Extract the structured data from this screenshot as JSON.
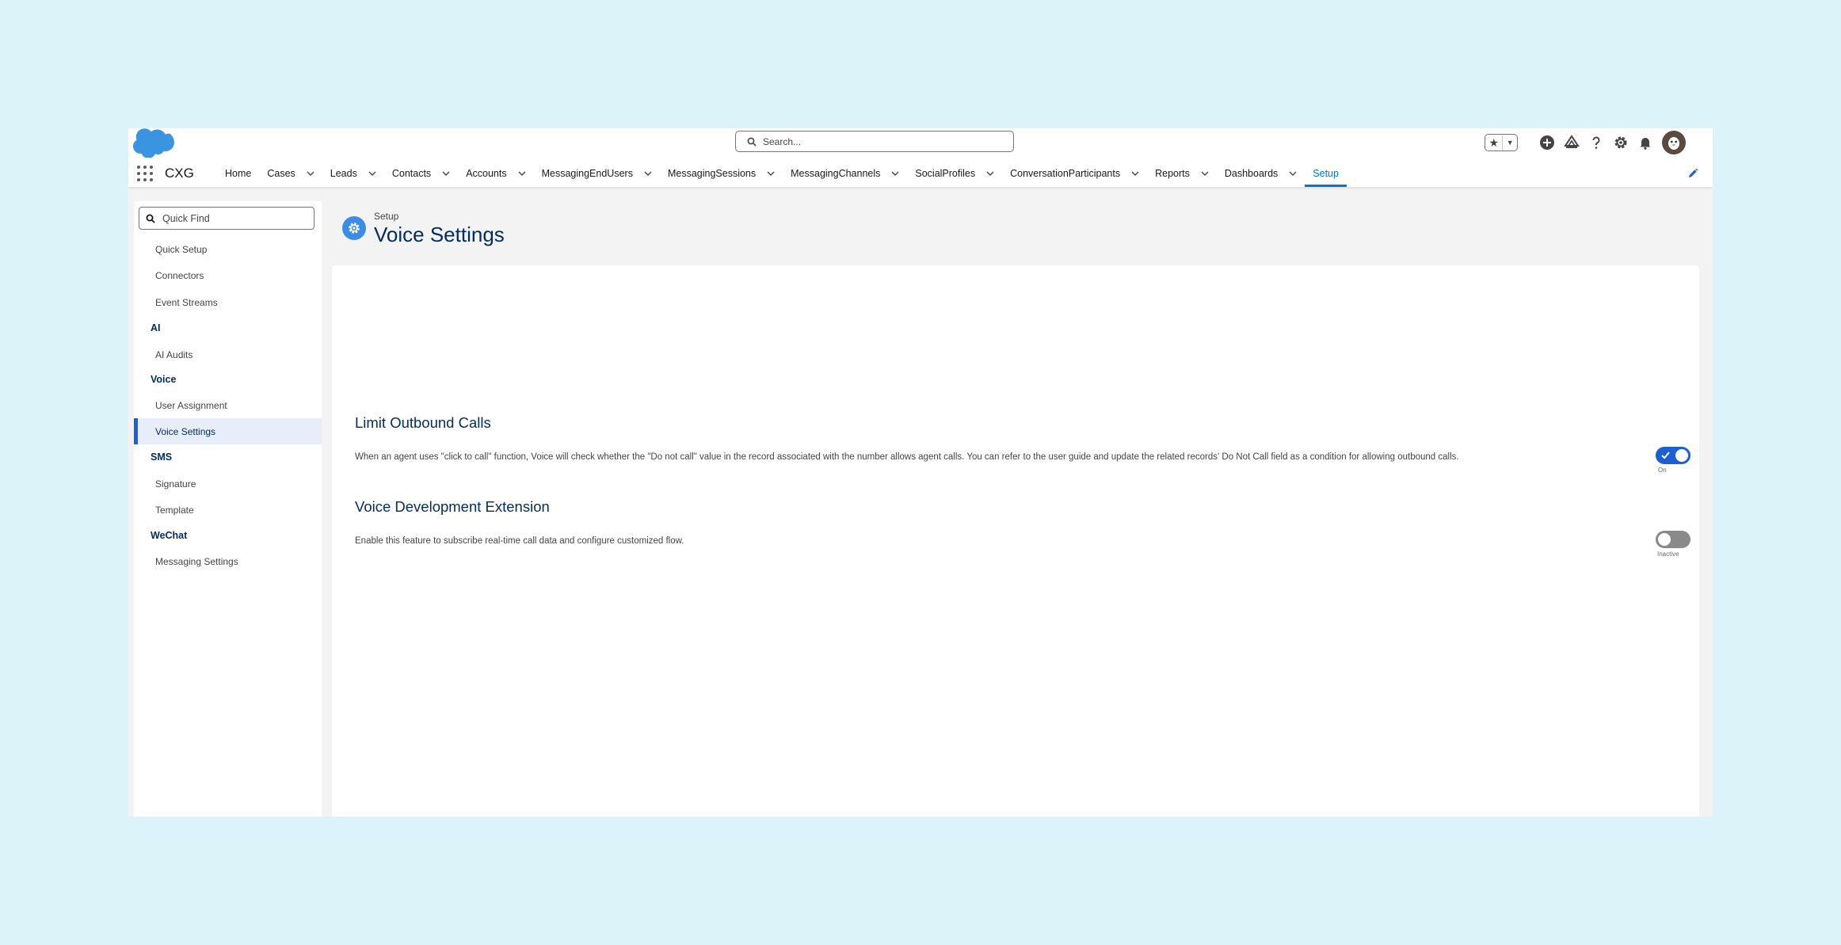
{
  "header": {
    "search_placeholder": "Search..."
  },
  "nav": {
    "app_name": "CXG",
    "items": [
      {
        "label": "Home",
        "has_menu": false
      },
      {
        "label": "Cases",
        "has_menu": true
      },
      {
        "label": "Leads",
        "has_menu": true
      },
      {
        "label": "Contacts",
        "has_menu": true
      },
      {
        "label": "Accounts",
        "has_menu": true
      },
      {
        "label": "MessagingEndUsers",
        "has_menu": true
      },
      {
        "label": "MessagingSessions",
        "has_menu": true
      },
      {
        "label": "MessagingChannels",
        "has_menu": true
      },
      {
        "label": "SocialProfiles",
        "has_menu": true
      },
      {
        "label": "ConversationParticipants",
        "has_menu": true
      },
      {
        "label": "Reports",
        "has_menu": true
      },
      {
        "label": "Dashboards",
        "has_menu": true
      },
      {
        "label": "Setup",
        "has_menu": false,
        "active": true
      }
    ]
  },
  "sidebar": {
    "quick_find_placeholder": "Quick Find",
    "items": [
      {
        "type": "item",
        "label": "Quick Setup"
      },
      {
        "type": "item",
        "label": "Connectors"
      },
      {
        "type": "item",
        "label": "Event Streams"
      },
      {
        "type": "section",
        "label": "AI"
      },
      {
        "type": "item",
        "label": "AI Audits"
      },
      {
        "type": "section",
        "label": "Voice"
      },
      {
        "type": "item",
        "label": "User Assignment"
      },
      {
        "type": "item",
        "label": "Voice Settings",
        "active": true
      },
      {
        "type": "section",
        "label": "SMS"
      },
      {
        "type": "item",
        "label": "Signature"
      },
      {
        "type": "item",
        "label": "Template"
      },
      {
        "type": "section",
        "label": "WeChat"
      },
      {
        "type": "item",
        "label": "Messaging Settings"
      }
    ]
  },
  "page": {
    "breadcrumb": "Setup",
    "title": "Voice Settings"
  },
  "settings": [
    {
      "title": "Limit Outbound Calls",
      "description": "When an agent uses \"click to call\" function, Voice will check whether the \"Do not call\" value in the record associated with the number allows agent calls. You can refer to the user guide and update the related records' Do Not Call field as a condition for allowing outbound calls.",
      "enabled": true,
      "status_label": "On"
    },
    {
      "title": "Voice Development Extension",
      "description": "Enable this feature to subscribe real-time call data and configure customized flow.",
      "enabled": false,
      "status_label": "Inactive"
    }
  ],
  "colors": {
    "accent": "#0176d3",
    "title_navy": "#032d60",
    "toggle_on": "#1b5fd1",
    "toggle_off": "#8a8a8a"
  }
}
